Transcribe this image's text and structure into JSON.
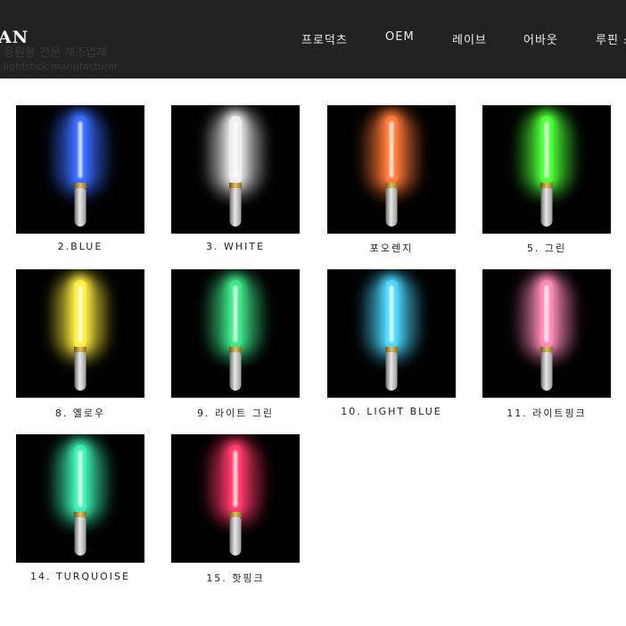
{
  "header": {
    "logo": "AN",
    "ghost_line1": "응원봉 전문 제조업체",
    "ghost_line2": "lightstick manufacturer",
    "nav": [
      "프로덕츠",
      "OEM",
      "레이브",
      "어바웃",
      "루핀 스"
    ]
  },
  "products": [
    {
      "label": "2.BLUE",
      "color": "#3a6cff"
    },
    {
      "label": "3. WHITE",
      "color": "#eeeeee"
    },
    {
      "label": "포오렌지",
      "color": "#ff7a3a"
    },
    {
      "label": "5. 그린",
      "color": "#4cff3a"
    },
    {
      "label": "8. 옐로우",
      "color": "#ffee44"
    },
    {
      "label": "9. 라이트 그린",
      "color": "#3ee68a"
    },
    {
      "label": "10. LIGHT BLUE",
      "color": "#4ed8ff"
    },
    {
      "label": "11. 라이트핑크",
      "color": "#ff8ab8"
    },
    {
      "label": "14. TURQUOISE",
      "color": "#3ef0b4"
    },
    {
      "label": "15. 핫핑크",
      "color": "#ff3a6a"
    }
  ]
}
